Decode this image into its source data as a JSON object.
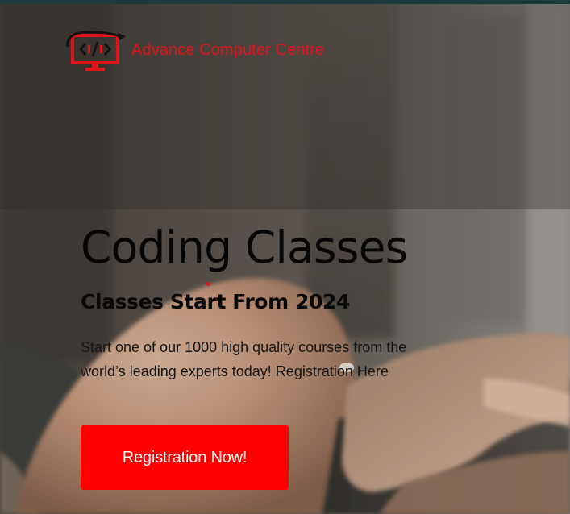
{
  "brand": {
    "name": "Advance Computer Centre",
    "logo_icon": "monitor-code-logo-icon",
    "logo_mark_text": "</>",
    "color": "#e0141a"
  },
  "hero": {
    "title": "Coding Classes",
    "subtitle": "Classes Start From 2024",
    "description": "Start one of our 1000 high quality courses from the world’s leading experts today! Registration Here",
    "background_image": "person-typing-on-laptop-photo"
  },
  "cta": {
    "label": "Registration Now!",
    "color": "#ff0000"
  },
  "colors": {
    "accent": "#ff0000",
    "top_strip": "#1f3a3d"
  }
}
